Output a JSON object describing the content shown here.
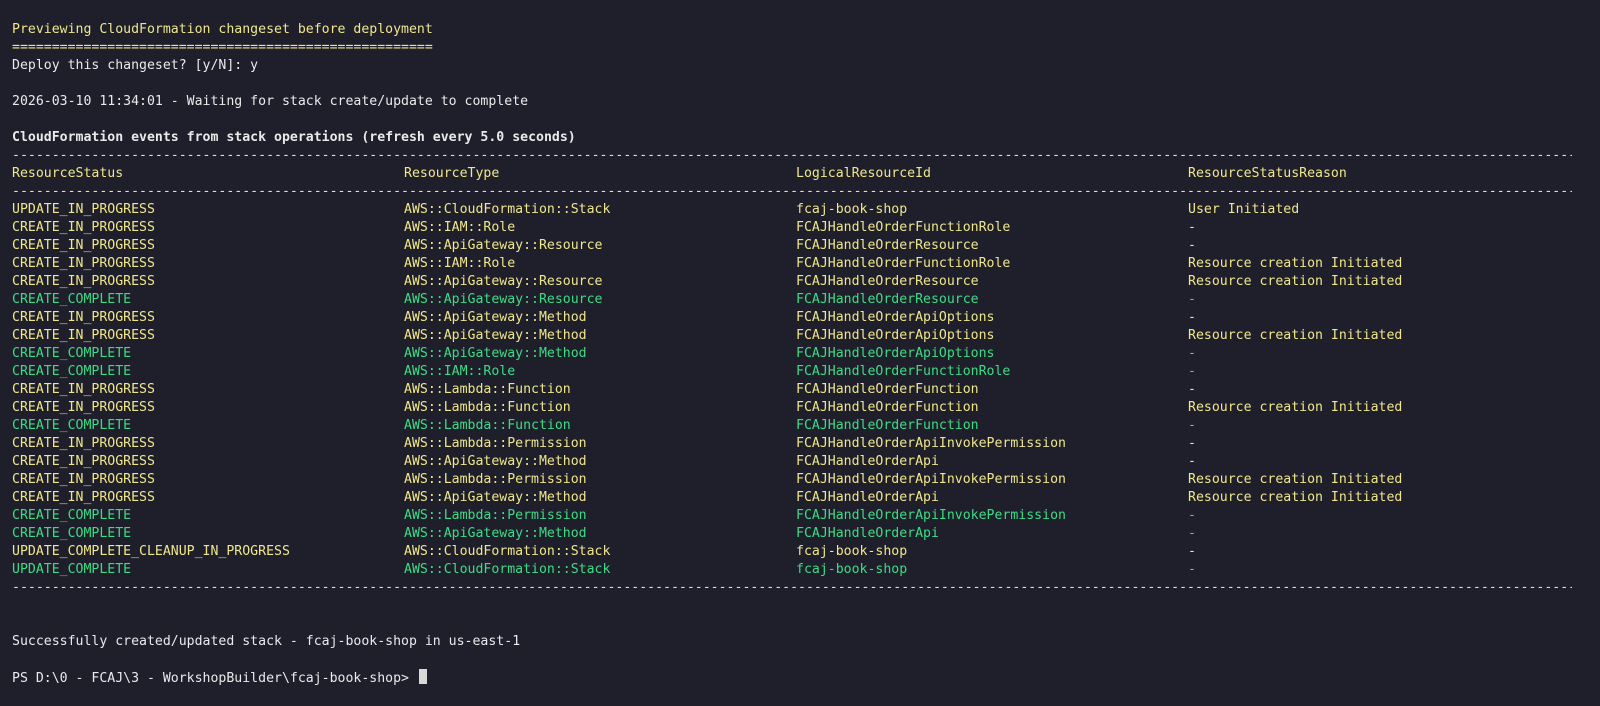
{
  "terminal": {
    "preview_title": "Previewing CloudFormation changeset before deployment",
    "separator_short": "=====================================================",
    "deploy_prompt": "Deploy this changeset? [y/N]: y",
    "waiting_line": "2026-03-10 11:34:01 - Waiting for stack create/update to complete",
    "events_title": "CloudFormation events from stack operations (refresh every 5.0 seconds)",
    "separator_long": "--------------------------------------------------------------------------------------------------------------------------------------------------------------------------------------------------------------------",
    "headers": [
      "ResourceStatus",
      "ResourceType",
      "LogicalResourceId",
      "ResourceStatusReason"
    ],
    "events": [
      {
        "status": "UPDATE_IN_PROGRESS",
        "type": "AWS::CloudFormation::Stack",
        "id": "fcaj-book-shop",
        "reason": "User Initiated",
        "color": "yellow"
      },
      {
        "status": "CREATE_IN_PROGRESS",
        "type": "AWS::IAM::Role",
        "id": "FCAJHandleOrderFunctionRole",
        "reason": "-",
        "color": "yellow"
      },
      {
        "status": "CREATE_IN_PROGRESS",
        "type": "AWS::ApiGateway::Resource",
        "id": "FCAJHandleOrderResource",
        "reason": "-",
        "color": "yellow"
      },
      {
        "status": "CREATE_IN_PROGRESS",
        "type": "AWS::IAM::Role",
        "id": "FCAJHandleOrderFunctionRole",
        "reason": "Resource creation Initiated",
        "color": "yellow"
      },
      {
        "status": "CREATE_IN_PROGRESS",
        "type": "AWS::ApiGateway::Resource",
        "id": "FCAJHandleOrderResource",
        "reason": "Resource creation Initiated",
        "color": "yellow"
      },
      {
        "status": "CREATE_COMPLETE",
        "type": "AWS::ApiGateway::Resource",
        "id": "FCAJHandleOrderResource",
        "reason": "-",
        "color": "green"
      },
      {
        "status": "CREATE_IN_PROGRESS",
        "type": "AWS::ApiGateway::Method",
        "id": "FCAJHandleOrderApiOptions",
        "reason": "-",
        "color": "yellow"
      },
      {
        "status": "CREATE_IN_PROGRESS",
        "type": "AWS::ApiGateway::Method",
        "id": "FCAJHandleOrderApiOptions",
        "reason": "Resource creation Initiated",
        "color": "yellow"
      },
      {
        "status": "CREATE_COMPLETE",
        "type": "AWS::ApiGateway::Method",
        "id": "FCAJHandleOrderApiOptions",
        "reason": "-",
        "color": "green"
      },
      {
        "status": "CREATE_COMPLETE",
        "type": "AWS::IAM::Role",
        "id": "FCAJHandleOrderFunctionRole",
        "reason": "-",
        "color": "green"
      },
      {
        "status": "CREATE_IN_PROGRESS",
        "type": "AWS::Lambda::Function",
        "id": "FCAJHandleOrderFunction",
        "reason": "-",
        "color": "yellow"
      },
      {
        "status": "CREATE_IN_PROGRESS",
        "type": "AWS::Lambda::Function",
        "id": "FCAJHandleOrderFunction",
        "reason": "Resource creation Initiated",
        "color": "yellow"
      },
      {
        "status": "CREATE_COMPLETE",
        "type": "AWS::Lambda::Function",
        "id": "FCAJHandleOrderFunction",
        "reason": "-",
        "color": "green"
      },
      {
        "status": "CREATE_IN_PROGRESS",
        "type": "AWS::Lambda::Permission",
        "id": "FCAJHandleOrderApiInvokePermission",
        "reason": "-",
        "color": "yellow"
      },
      {
        "status": "CREATE_IN_PROGRESS",
        "type": "AWS::ApiGateway::Method",
        "id": "FCAJHandleOrderApi",
        "reason": "-",
        "color": "yellow"
      },
      {
        "status": "CREATE_IN_PROGRESS",
        "type": "AWS::Lambda::Permission",
        "id": "FCAJHandleOrderApiInvokePermission",
        "reason": "Resource creation Initiated",
        "color": "yellow"
      },
      {
        "status": "CREATE_IN_PROGRESS",
        "type": "AWS::ApiGateway::Method",
        "id": "FCAJHandleOrderApi",
        "reason": "Resource creation Initiated",
        "color": "yellow"
      },
      {
        "status": "CREATE_COMPLETE",
        "type": "AWS::Lambda::Permission",
        "id": "FCAJHandleOrderApiInvokePermission",
        "reason": "-",
        "color": "green"
      },
      {
        "status": "CREATE_COMPLETE",
        "type": "AWS::ApiGateway::Method",
        "id": "FCAJHandleOrderApi",
        "reason": "-",
        "color": "green"
      },
      {
        "status": "UPDATE_COMPLETE_CLEANUP_IN_PROGRESS",
        "type": "AWS::CloudFormation::Stack",
        "id": "fcaj-book-shop",
        "reason": "-",
        "color": "yellow"
      },
      {
        "status": "UPDATE_COMPLETE",
        "type": "AWS::CloudFormation::Stack",
        "id": "fcaj-book-shop",
        "reason": "-",
        "color": "green"
      }
    ],
    "success_line": "Successfully created/updated stack - fcaj-book-shop in us-east-1",
    "prompt": "PS D:\\0 - FCAJ\\3 - WorkshopBuilder\\fcaj-book-shop> "
  },
  "colors": {
    "background": "#1e1f2b",
    "yellow": "#f0e68c",
    "green": "#3ddc84",
    "white": "#eaeaea"
  }
}
